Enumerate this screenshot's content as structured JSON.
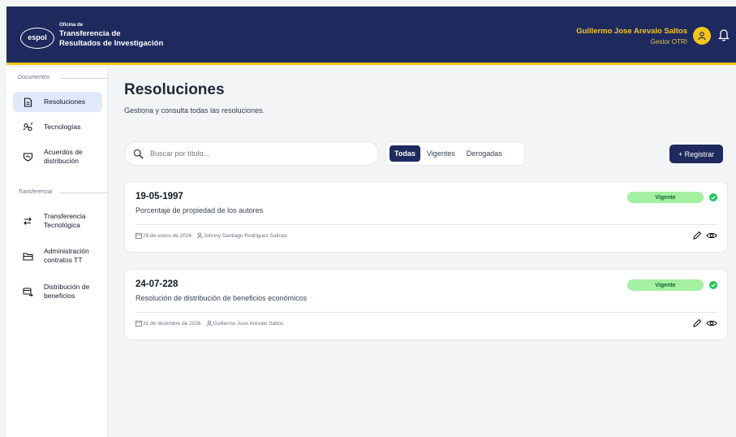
{
  "header": {
    "logo_text": "espol",
    "org_small": "Oficina de",
    "org_line1": "Transferencia de",
    "org_line2": "Resultados de Investigación",
    "user_name": "Guillermo Jose Arevalo Saltos",
    "user_role": "Gestor OTRI"
  },
  "sidebar": {
    "section_documentos": "Documentos",
    "section_transferencia": "Transferencia",
    "items": [
      {
        "label": "Resoluciones",
        "icon": "document-icon"
      },
      {
        "label": "Tecnologías",
        "icon": "gears-icon"
      },
      {
        "label": "Acuerdos de distribución",
        "icon": "handshake-icon"
      },
      {
        "label": "Transferencia Tecnológica",
        "icon": "transfer-icon"
      },
      {
        "label": "Administración contratos TT",
        "icon": "folder-icon"
      },
      {
        "label": "Distribución de beneficios",
        "icon": "payment-icon"
      }
    ]
  },
  "main": {
    "title": "Resoluciones",
    "subtitle": "Gestiona y consulta todas las resoluciones.",
    "search_placeholder": "Buscar por título...",
    "filters": [
      "Todas",
      "Vigentes",
      "Derogadas"
    ],
    "active_filter": "Todas",
    "register_label": "+ Registrar"
  },
  "cards": [
    {
      "code": "19-05-1997",
      "description": "Porcentaje de propiedad de los autores",
      "date": "29 de enero de 2026",
      "author": "Johnny Santiago Rodriguez Salinas",
      "status": "Vigente"
    },
    {
      "code": "24-07-228",
      "description": "Resolución de distribución de beneficios económicos",
      "date": "31 de diciembre de 2026",
      "author": "Guillermo Jose Arevalo Saltos",
      "status": "Vigente"
    }
  ],
  "colors": {
    "header_bg": "#1e2a5e",
    "accent": "#f5c518",
    "badge_bg": "#a3f0a0",
    "status_ok": "#22c55e"
  }
}
